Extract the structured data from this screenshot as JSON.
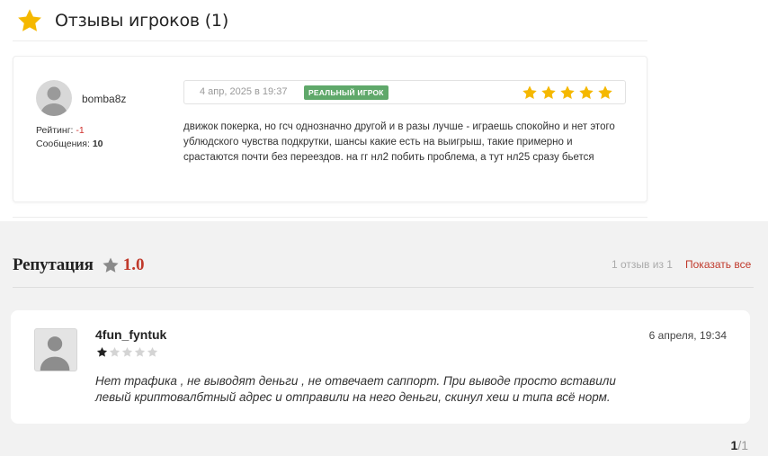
{
  "players_reviews": {
    "title": "Отзывы игроков (1)",
    "review": {
      "username": "bomba8z",
      "rating_label": "Рейтинг:",
      "rating_value": "-1",
      "messages_label": "Сообщения:",
      "messages_value": "10",
      "date": "4 апр, 2025 в 19:37",
      "badge": "РЕАЛЬНЫЙ ИГРОК",
      "stars": 5,
      "text": "движок покерка, но гсч однозначно другой и в разы лучше - играешь спокойно и нет этого ублюдского чувства подкрутки, шансы какие есть на выигрыш, такие примерно и срастаются почти без переездов. на гг нл2 побить проблема, а тут нл25 сразу бьется"
    }
  },
  "reputation": {
    "title": "Репутация",
    "score": "1.0",
    "count_text": "1 отзыв из 1",
    "show_all": "Показать все",
    "review": {
      "username": "4fun_fyntuk",
      "stars_filled": 1,
      "stars_total": 5,
      "date": "6 апреля, 19:34",
      "text": "Нет трафика , не выводят деньги , не отвечает саппорт. При выводе просто вставили левый криптовалбтный адрес и отправили на него деньги, скинул хеш и типа всё норм."
    }
  },
  "pagination": {
    "current": "1",
    "separator": "/",
    "total": "1"
  },
  "colors": {
    "gold_star": "#f5b800",
    "badge_green": "#5fa86a",
    "accent_red": "#c0392b",
    "rep_bg": "#f2f2f2"
  }
}
